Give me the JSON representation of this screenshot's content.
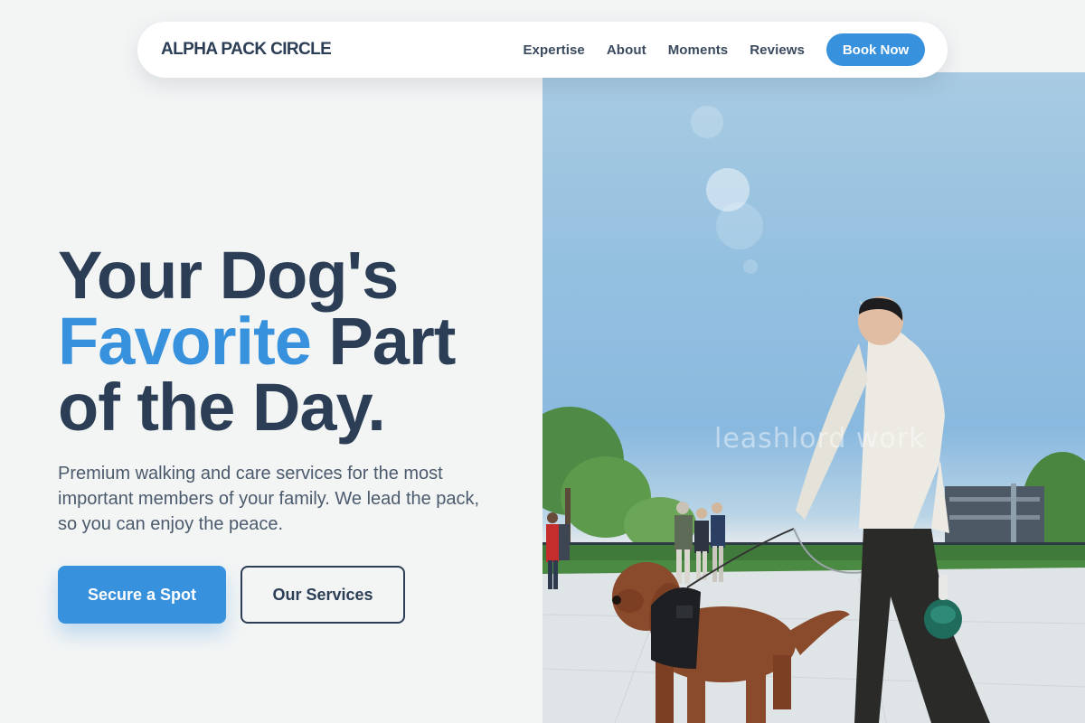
{
  "nav": {
    "brand": "ALPHA PACK CIRCLE",
    "links": [
      "Expertise",
      "About",
      "Moments",
      "Reviews"
    ],
    "cta": "Book Now"
  },
  "hero": {
    "headline_line1": "Your Dog's",
    "headline_accent": "Favorite",
    "headline_line2_rest": " Part",
    "headline_line3": "of the Day.",
    "subtitle": "Premium walking and care services for the most important members of your family. We lead the pack, so you can enjoy the peace.",
    "primary_button": "Secure a Spot",
    "secondary_button": "Our Services"
  },
  "photo": {
    "watermark": "leashlord work",
    "subject": "person walking a brown curly-coated dog on a leash along a sunny promenade"
  },
  "colors": {
    "accent": "#3891dc",
    "text_dark": "#2c3e55",
    "background": "#f3f5f5"
  }
}
